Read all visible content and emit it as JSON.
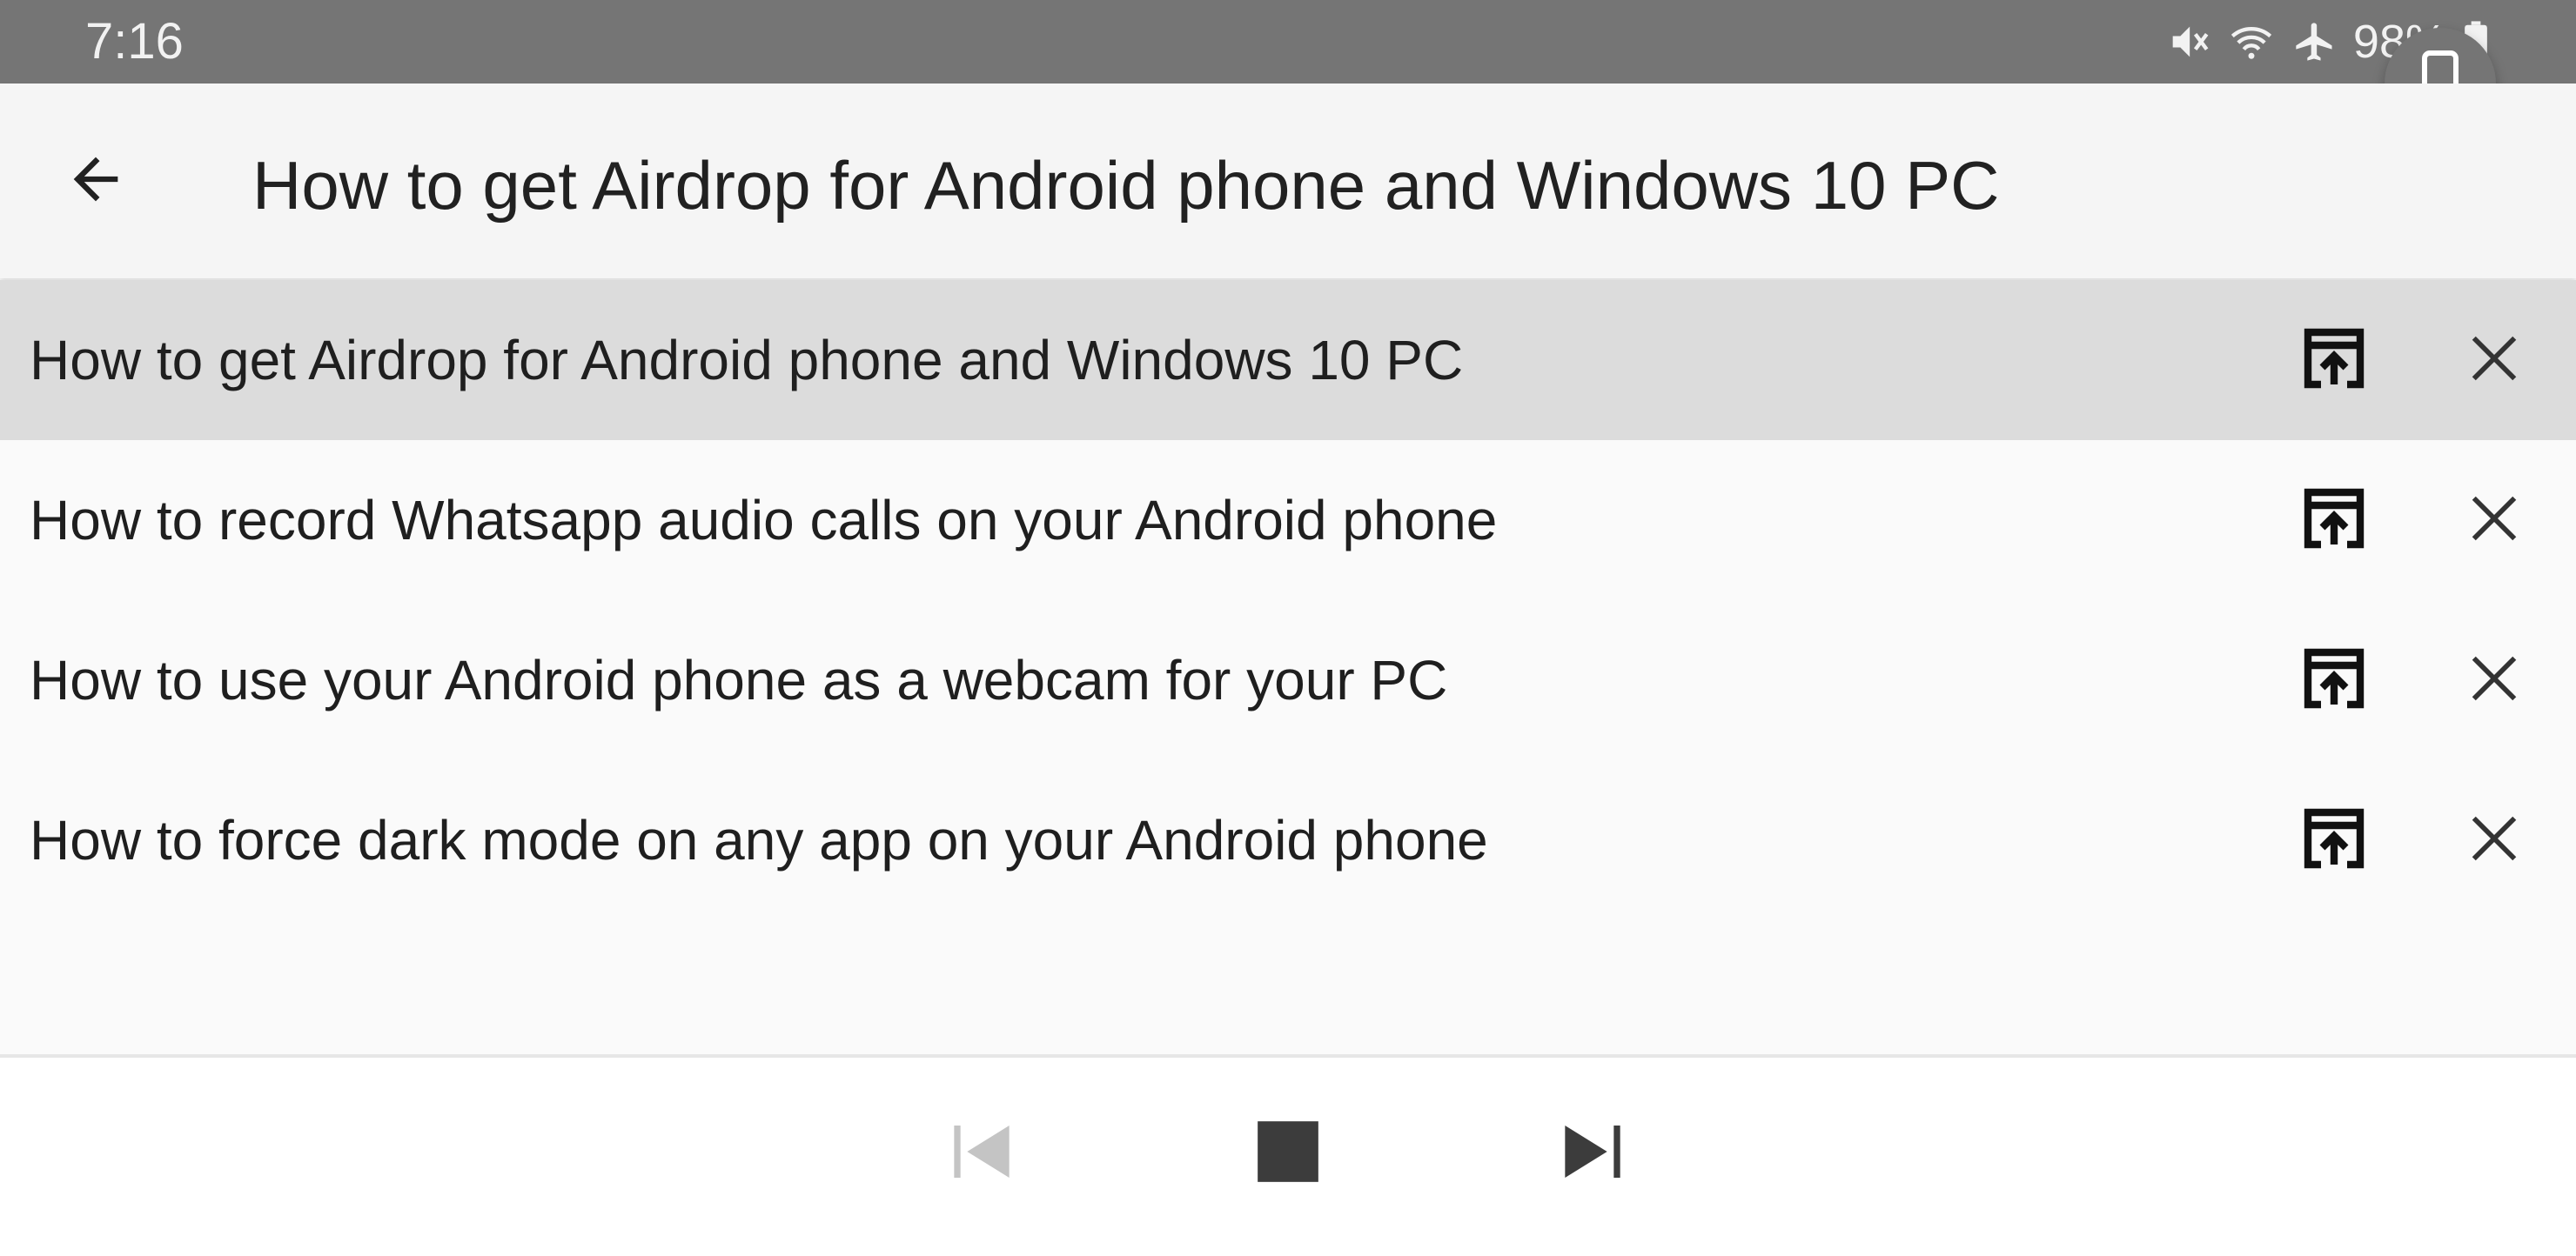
{
  "status_bar": {
    "time": "7:16",
    "battery": "98%",
    "icons": [
      "vibrate-mute-icon",
      "wifi-icon",
      "airplane-mode-icon",
      "battery-icon"
    ]
  },
  "floating_button": {
    "icon": "phone-icon"
  },
  "app_bar": {
    "back_icon": "arrow-back-icon",
    "title": "How to get Airdrop for Android phone and Windows 10 PC"
  },
  "list": {
    "selected_index": 0,
    "items": [
      {
        "label": "How to get Airdrop for Android phone and Windows 10 PC"
      },
      {
        "label": "How to record Whatsapp audio calls on your Android phone"
      },
      {
        "label": "How to use your Android phone as a webcam for your PC"
      },
      {
        "label": "How to force dark mode on any app on your Android phone"
      }
    ],
    "item_action_icons": [
      "open-in-icon",
      "close-icon"
    ]
  },
  "player_controls": {
    "icons": [
      "skip-previous-icon",
      "stop-icon",
      "skip-next-icon"
    ],
    "previous_enabled": false
  },
  "colors": {
    "status_bar": "#757575",
    "app_bar": "#f5f5f5",
    "selected_row": "#dcdcdc",
    "text": "#212121",
    "control_icon": "#3c3c3c",
    "disabled_icon": "#c4c4c4"
  }
}
